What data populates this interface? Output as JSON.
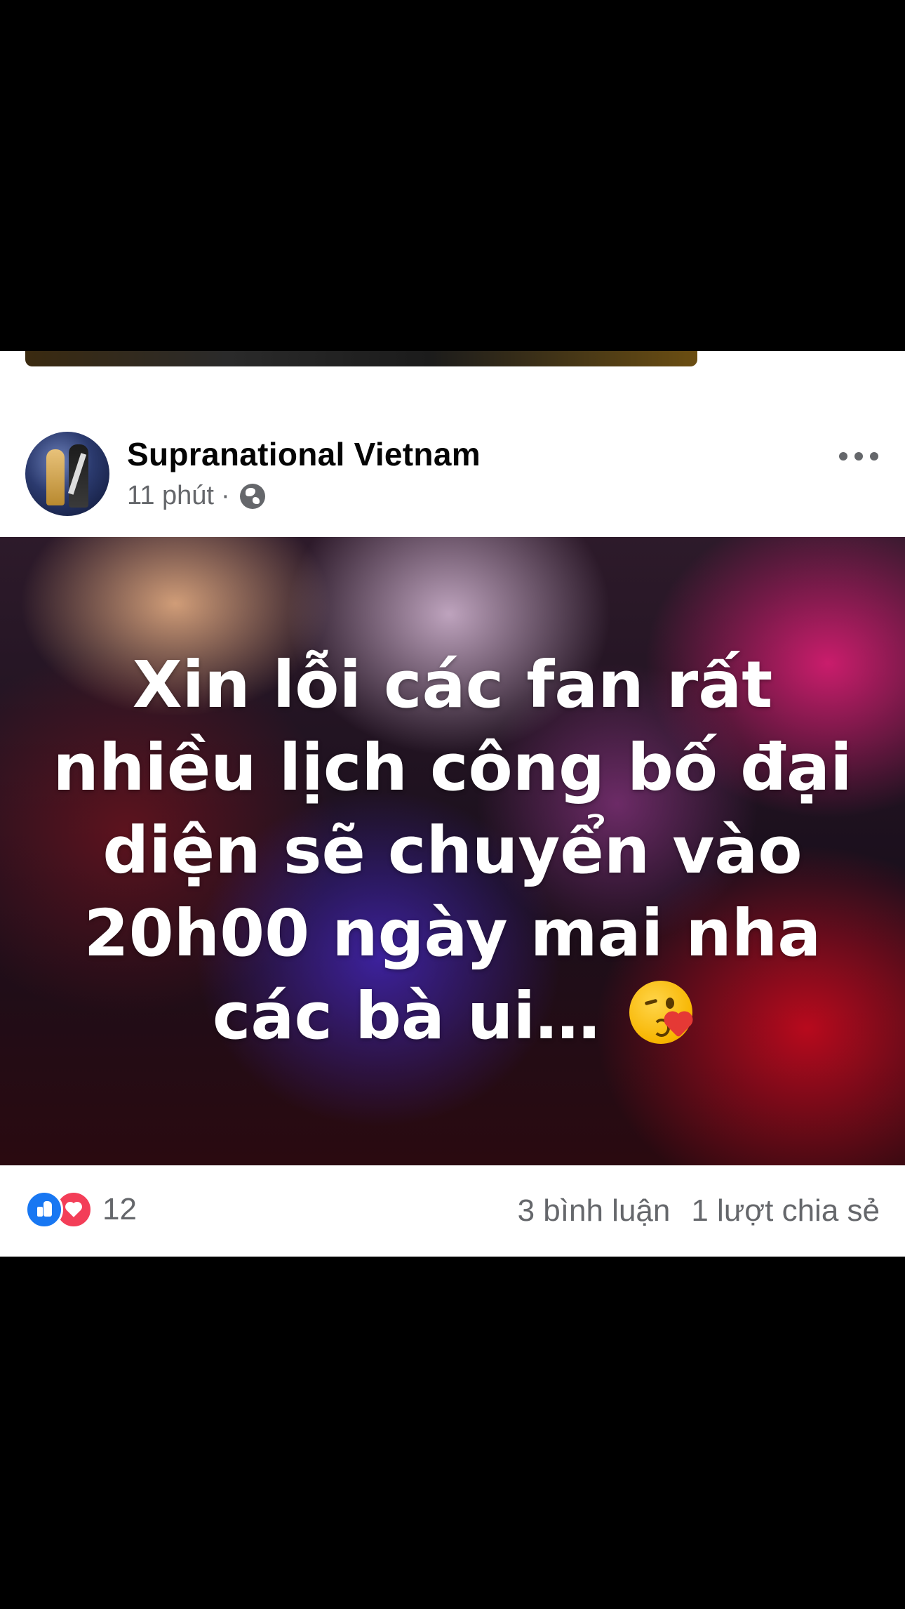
{
  "post": {
    "page_name": "Supranational Vietnam",
    "time": "11 phút",
    "separator": "·",
    "privacy_icon": "globe-icon",
    "more_icon": "more-horizontal-icon",
    "text_line1": "Xin lỗi các fan rất",
    "text_line2": "nhiều lịch công bố đại",
    "text_line3": "diện sẽ chuyển vào",
    "text_line4": "20h00 ngày mai nha",
    "text_line5": "các bà ui…",
    "emoji": "kissing-face-heart-emoji"
  },
  "footer": {
    "reaction_icons": [
      "like-icon",
      "love-icon"
    ],
    "reaction_count": "12",
    "comments": "3 bình luận",
    "shares": "1 lượt chia sẻ"
  },
  "colors": {
    "like_blue": "#1877f2",
    "love_red": "#f33e58",
    "meta_gray": "#65676b"
  }
}
